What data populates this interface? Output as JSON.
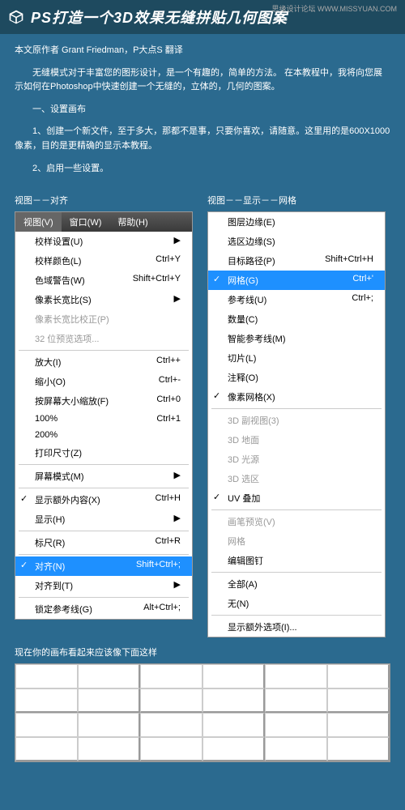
{
  "watermark": "思缘设计论坛  WWW.MISSYUAN.COM",
  "title": "PS打造一个3D效果无缝拼贴几何图案",
  "paragraphs": {
    "author": "本文原作者 Grant Friedman，P大点S 翻译",
    "intro": "　　无缝模式对于丰富您的图形设计，是一个有趣的，简单的方法。 在本教程中，我将向您展示如何在Photoshop中快速创建一个无缝的，立体的，几何的图案。",
    "h1": "　　一、设置画布",
    "step1": "　　1、创建一个新文件，至于多大，那都不是事，只要你喜欢，请随意。这里用的是600X1000像素，目的是更精确的显示本教程。",
    "step2": "　　2、启用一些设置。",
    "gridcap": "现在你的画布看起来应该像下面这样"
  },
  "menuLeft": {
    "label": "视图－－对齐",
    "bar": [
      "视图(V)",
      "窗口(W)",
      "帮助(H)"
    ],
    "items": [
      {
        "t": "校样设置(U)",
        "sub": true
      },
      {
        "t": "校样颜色(L)",
        "s": "Ctrl+Y"
      },
      {
        "t": "色域警告(W)",
        "s": "Shift+Ctrl+Y"
      },
      {
        "t": "像素长宽比(S)",
        "sub": true
      },
      {
        "t": "像素长宽比校正(P)",
        "dis": true
      },
      {
        "t": "32 位预览选项...",
        "dis": true
      },
      {
        "sep": true
      },
      {
        "t": "放大(I)",
        "s": "Ctrl++"
      },
      {
        "t": "缩小(O)",
        "s": "Ctrl+-"
      },
      {
        "t": "按屏幕大小缩放(F)",
        "s": "Ctrl+0"
      },
      {
        "t": "100%",
        "s": "Ctrl+1"
      },
      {
        "t": "200%"
      },
      {
        "t": "打印尺寸(Z)"
      },
      {
        "sep": true
      },
      {
        "t": "屏幕模式(M)",
        "sub": true
      },
      {
        "sep": true
      },
      {
        "t": "显示额外内容(X)",
        "s": "Ctrl+H",
        "chk": true
      },
      {
        "t": "显示(H)",
        "sub": true
      },
      {
        "sep": true
      },
      {
        "t": "标尺(R)",
        "s": "Ctrl+R"
      },
      {
        "sep": true
      },
      {
        "t": "对齐(N)",
        "s": "Shift+Ctrl+;",
        "chk": true,
        "sel": true
      },
      {
        "t": "对齐到(T)",
        "sub": true
      },
      {
        "sep": true
      },
      {
        "t": "锁定参考线(G)",
        "s": "Alt+Ctrl+;"
      }
    ]
  },
  "menuRight": {
    "label": "视图－－显示－－网格",
    "items": [
      {
        "t": "图层边缘(E)"
      },
      {
        "t": "选区边缘(S)"
      },
      {
        "t": "目标路径(P)",
        "s": "Shift+Ctrl+H"
      },
      {
        "t": "网格(G)",
        "s": "Ctrl+'",
        "chk": true,
        "sel": true
      },
      {
        "t": "参考线(U)",
        "s": "Ctrl+;"
      },
      {
        "t": "数量(C)"
      },
      {
        "t": "智能参考线(M)"
      },
      {
        "t": "切片(L)"
      },
      {
        "t": "注释(O)"
      },
      {
        "t": "像素网格(X)",
        "chk": true
      },
      {
        "sep": true
      },
      {
        "t": "3D 副视图(3)",
        "dis": true
      },
      {
        "t": "3D 地面",
        "dis": true
      },
      {
        "t": "3D 光源",
        "dis": true
      },
      {
        "t": "3D 选区",
        "dis": true
      },
      {
        "t": "UV 叠加",
        "chk": true
      },
      {
        "sep": true
      },
      {
        "t": "画笔预览(V)",
        "dis": true
      },
      {
        "t": "网格",
        "dis": true
      },
      {
        "t": "编辑图钉"
      },
      {
        "sep": true
      },
      {
        "t": "全部(A)"
      },
      {
        "t": "无(N)"
      },
      {
        "sep": true
      },
      {
        "t": "显示额外选项(I)..."
      }
    ]
  }
}
